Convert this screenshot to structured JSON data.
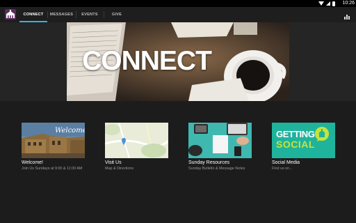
{
  "status_bar": {
    "time": "10:26"
  },
  "app": {
    "logo_icon": "church-icon"
  },
  "tabs": [
    {
      "label": "CONNECT",
      "active": true
    },
    {
      "label": "MESSAGES",
      "active": false
    },
    {
      "label": "EVENTS",
      "active": false
    },
    {
      "label": "GIVE",
      "active": false
    }
  ],
  "hero": {
    "title": "CONNECT"
  },
  "cards": [
    {
      "title": "Welcome!",
      "subtitle": "Join Us Sundays at 9:00 & 11:00 AM",
      "thumb_text": "Welcome"
    },
    {
      "title": "Visit Us",
      "subtitle": "Map & Directions"
    },
    {
      "title": "Sunday Resources",
      "subtitle": "Sunday Bulletin & Message Notes"
    },
    {
      "title": "Social Media",
      "subtitle": "Find us on...",
      "thumb_text_1": "GETTING",
      "thumb_text_2": "SOCIAL"
    }
  ],
  "colors": {
    "accent": "#33b5e5",
    "logo_bg": "#5c2a5e",
    "social_bg": "#1fb39c",
    "social_text": "#c6e33b"
  }
}
